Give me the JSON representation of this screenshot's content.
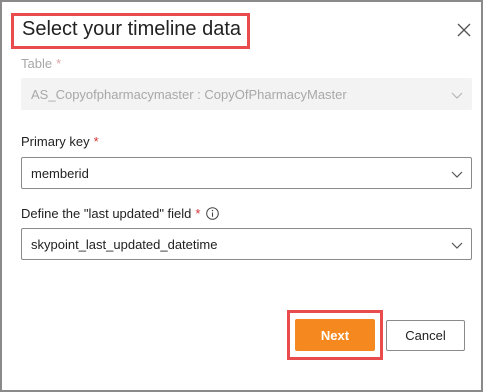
{
  "dialog": {
    "title": "Select your timeline data"
  },
  "fields": {
    "table": {
      "label": "Table",
      "required_mark": "*",
      "value": "AS_Copyofpharmacymaster : CopyOfPharmacyMaster",
      "disabled": true
    },
    "primary_key": {
      "label": "Primary key",
      "required_mark": "*",
      "value": "memberid"
    },
    "last_updated": {
      "label": "Define the \"last updated\" field",
      "required_mark": "*",
      "value": "skypoint_last_updated_datetime"
    }
  },
  "actions": {
    "next_label": "Next",
    "cancel_label": "Cancel"
  },
  "icons": {
    "close": "close-icon",
    "chevron": "chevron-down-icon",
    "info": "info-icon"
  },
  "colors": {
    "primary_button": "#f5891f",
    "highlight": "#e84c4c",
    "required": "#d13438"
  }
}
